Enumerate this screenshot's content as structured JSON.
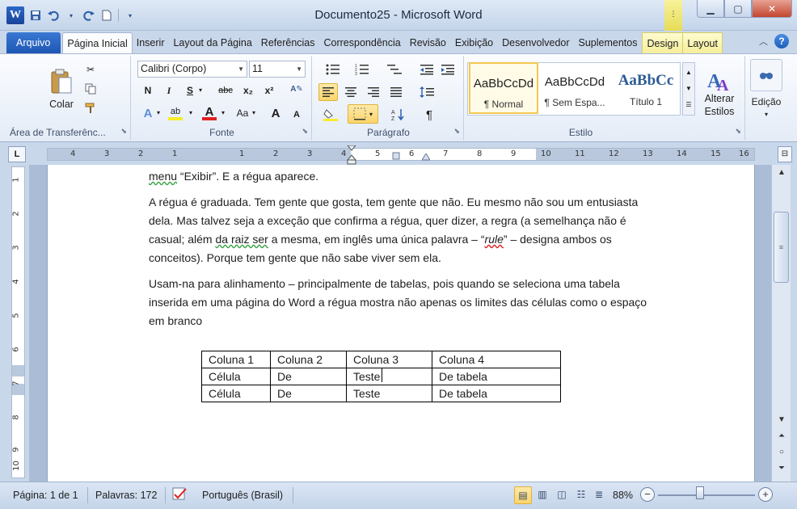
{
  "window": {
    "title": "Documento25 - Microsoft Word",
    "minimize": "▁",
    "maximize": "▢",
    "close": "✕"
  },
  "qat": {
    "app_icon_letter": "W",
    "save_icon": "save-icon",
    "undo_icon": "undo-icon",
    "redo_icon": "redo-icon",
    "new_icon": "new-document-icon"
  },
  "tabs": [
    {
      "label": "Arquivo"
    },
    {
      "label": "Página Inicial"
    },
    {
      "label": "Inserir"
    },
    {
      "label": "Layout da Página"
    },
    {
      "label": "Referências"
    },
    {
      "label": "Correspondência"
    },
    {
      "label": "Revisão"
    },
    {
      "label": "Exibição"
    },
    {
      "label": "Desenvolvedor"
    },
    {
      "label": "Suplementos"
    },
    {
      "label": "Design"
    },
    {
      "label": "Layout"
    }
  ],
  "ribbon": {
    "clipboard": {
      "label": "Área de Transferênc...",
      "paste": "Colar"
    },
    "font": {
      "label": "Fonte",
      "font_name": "Calibri (Corpo)",
      "font_size": "11",
      "bold": "N",
      "italic": "I",
      "underline": "S",
      "strike": "abc",
      "subscript": "x₂",
      "superscript": "x²",
      "grow": "A",
      "shrink": "A",
      "change_case": "Aa"
    },
    "paragraph": {
      "label": "Parágrafo",
      "pilcrow": "¶"
    },
    "styles": {
      "label": "Estilo",
      "items": [
        {
          "sample": "AaBbCcDd",
          "name": "¶ Normal"
        },
        {
          "sample": "AaBbCcDd",
          "name": "¶ Sem Espa..."
        },
        {
          "sample": "AaBbCc",
          "name": "Título 1"
        }
      ],
      "change_styles": "Alterar Estilos"
    },
    "editing": {
      "label": "Edição"
    }
  },
  "ruler": {
    "tab_selector": "L",
    "numbers": [
      "4",
      "3",
      "2",
      "1",
      "1",
      "2",
      "3",
      "4",
      "5",
      "6",
      "7",
      "8",
      "9",
      "10",
      "11",
      "12",
      "13",
      "14",
      "15",
      "16"
    ],
    "vertical_numbers": [
      "1",
      "2",
      "3",
      "4",
      "5",
      "6",
      "7",
      "8",
      "9",
      "10"
    ]
  },
  "document": {
    "line1_a": "menu",
    "line1_b": " “Exibir”. E a régua aparece.",
    "para2_a": "A régua é graduada. Tem gente que gosta, tem gente que não. Eu mesmo não sou um entusiasta  dela. Mas talvez seja a exceção que confirma a régua, quer dizer, a regra (a semelhança não é casual; além ",
    "para2_b": "da raiz ser",
    "para2_c": " a mesma, em inglês uma única palavra – “",
    "para2_d": "rule",
    "para2_e": "” – designa ambos os conceitos). Porque tem gente que não sabe viver sem ela.",
    "para3": "Usam-na para alinhamento – principalmente de tabelas, pois quando se seleciona uma tabela inserida em uma página do Word a régua mostra não apenas os limites das células como o espaço em branco",
    "table": [
      [
        "Coluna 1",
        "Coluna 2",
        "Coluna 3",
        "Coluna 4"
      ],
      [
        "Célula",
        "De",
        "Teste",
        "De tabela"
      ],
      [
        "Célula",
        "De",
        "Teste",
        "De tabela"
      ]
    ]
  },
  "status": {
    "page": "Página: 1 de 1",
    "words": "Palavras: 172",
    "language": "Português (Brasil)",
    "zoom": "88%",
    "zoom_out": "−",
    "zoom_in": "+"
  }
}
